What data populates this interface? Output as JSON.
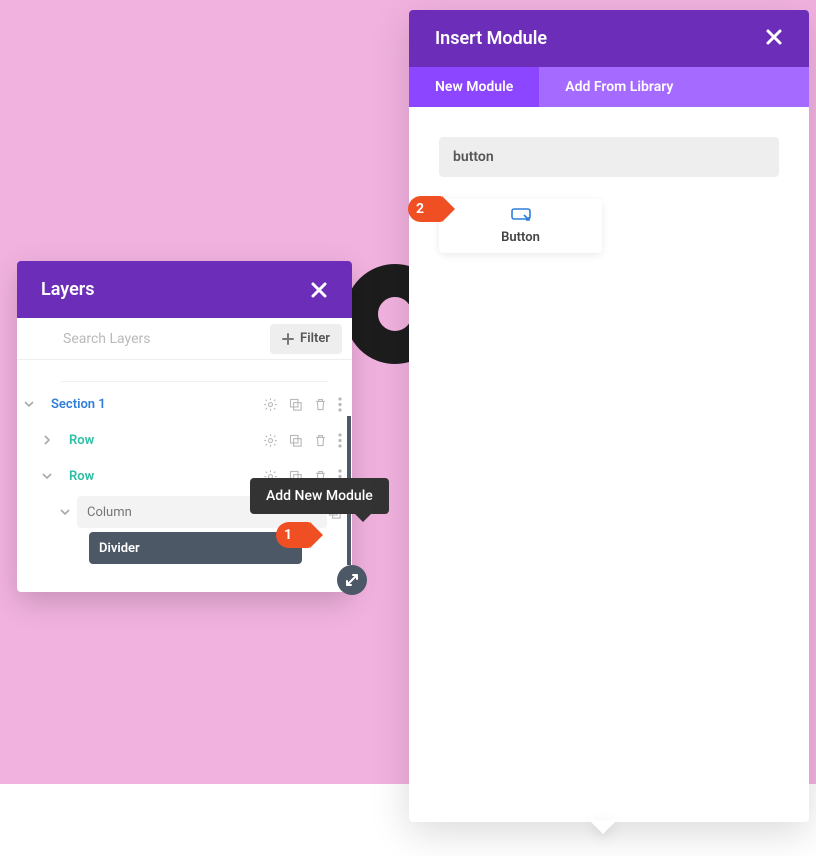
{
  "layers_panel": {
    "title": "Layers",
    "search_placeholder": "Search Layers",
    "filter_label": "Filter",
    "tree": {
      "section": "Section 1",
      "row1": "Row",
      "row2": "Row",
      "column": "Column",
      "divider": "Divider"
    }
  },
  "tooltip": "Add New Module",
  "insert_panel": {
    "title": "Insert Module",
    "tab_new": "New Module",
    "tab_lib": "Add From Library",
    "search_value": "button",
    "module_button": "Button"
  },
  "badges": {
    "one": "1",
    "two": "2"
  },
  "colors": {
    "purple": "#6c2eb9",
    "purple_tab_active": "#8c46ff",
    "purple_tab_inactive": "#a56aff",
    "pink_bg": "#f2b2e0",
    "slate": "#4c5866",
    "orange": "#f04e23",
    "link_blue": "#2f7fd9",
    "teal": "#2bbfa3"
  }
}
